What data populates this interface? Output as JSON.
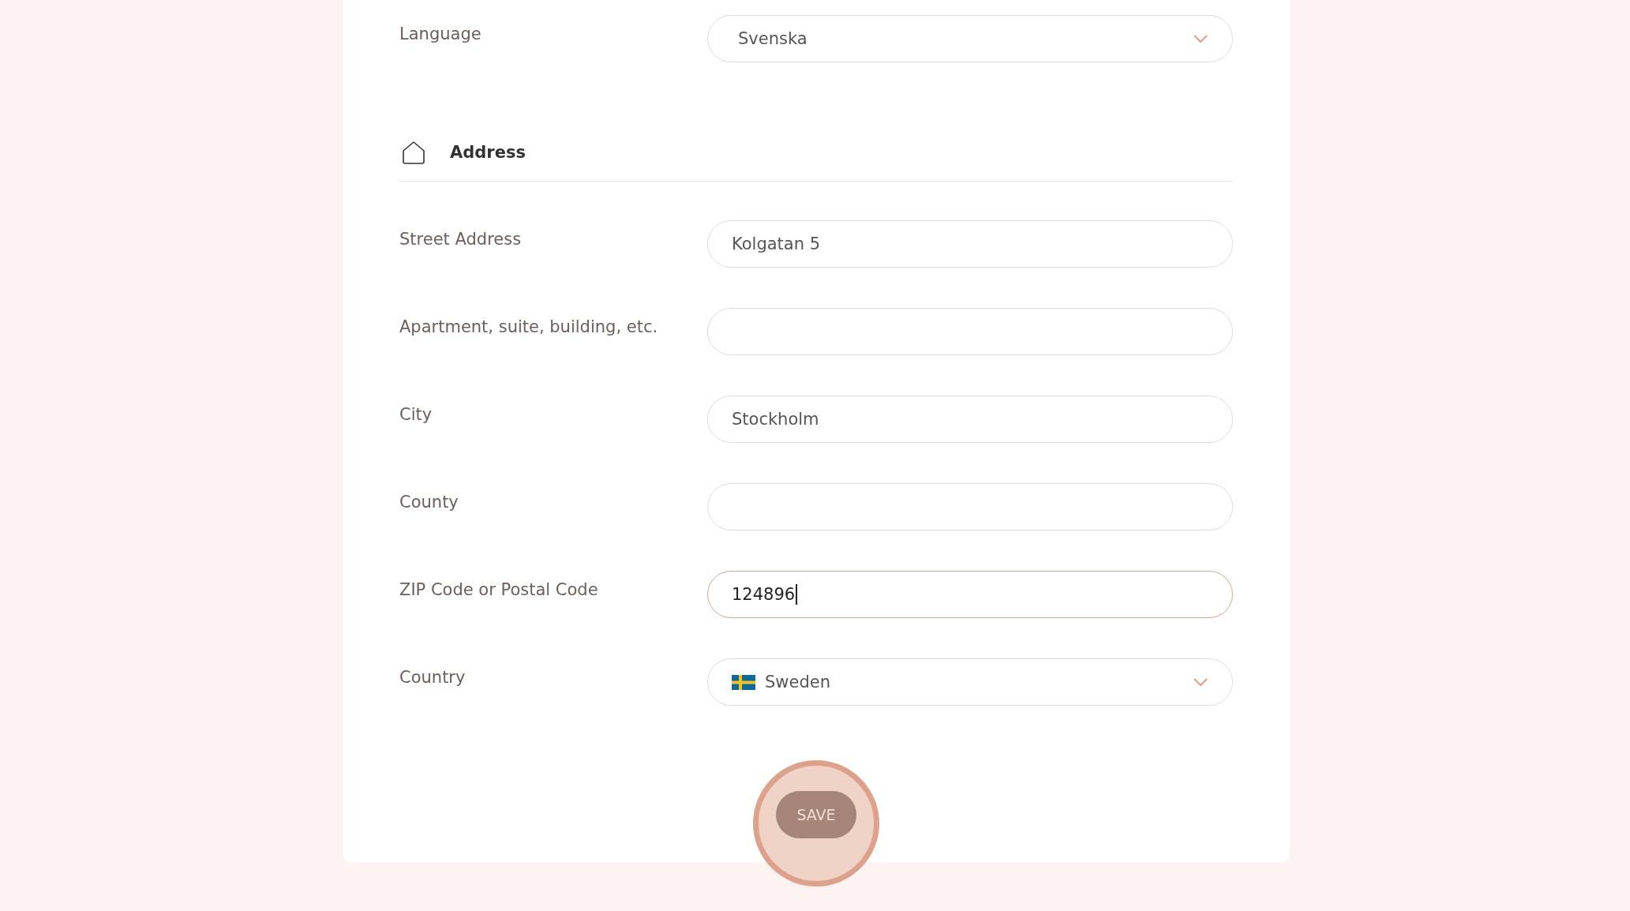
{
  "language": {
    "label": "Language",
    "value": "Svenska"
  },
  "section": {
    "title": "Address"
  },
  "fields": [
    {
      "kind": "text",
      "label": "Street Address",
      "value": "Kolgatan 5",
      "focused": false
    },
    {
      "kind": "text",
      "label": "Apartment, suite, building, etc.",
      "focused": false
    },
    {
      "kind": "text",
      "label": "City",
      "value": "Stockholm",
      "focused": false
    },
    {
      "kind": "text",
      "label": "County",
      "focused": false
    },
    {
      "kind": "text",
      "label": "ZIP Code or Postal Code",
      "value": "124896",
      "focused": true
    },
    {
      "kind": "country",
      "label": "Country",
      "value": "Sweden",
      "focused": false
    }
  ],
  "save_button": {
    "label": "SAVE",
    "highlighted": true
  }
}
